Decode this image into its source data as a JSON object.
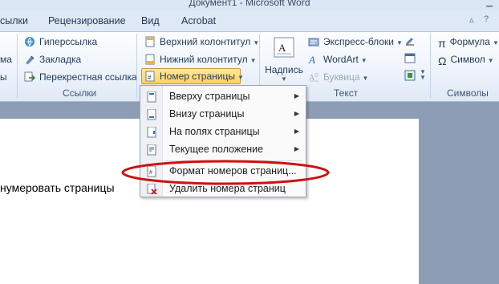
{
  "window": {
    "title": "Документ1 - Microsoft Word"
  },
  "tabs": [
    {
      "label": "сылки",
      "id": "links"
    },
    {
      "label": "Рецензирование",
      "id": "review"
    },
    {
      "label": "Вид",
      "id": "view"
    },
    {
      "label": "Acrobat",
      "id": "acrobat"
    }
  ],
  "ribbon": {
    "left_partial": [
      "ма",
      "ы"
    ],
    "links_group": {
      "label": "Ссылки",
      "items": [
        "Гиперссылка",
        "Закладка",
        "Перекрестная ссылка"
      ]
    },
    "header_footer_group": {
      "items": [
        "Верхний колонтитул",
        "Нижний колонтитул",
        "Номер страницы"
      ]
    },
    "text_group": {
      "label": "Текст",
      "textbox_label": "Надпись",
      "items": [
        "Экспресс-блоки",
        "WordArt",
        "Буквица"
      ]
    },
    "symbols_group": {
      "label": "Символы",
      "items": [
        "Формула",
        "Символ"
      ]
    }
  },
  "document": {
    "visible_text": "нумеровать страницы"
  },
  "menu": {
    "items": [
      {
        "label": "Вверху страницы",
        "submenu": true
      },
      {
        "label": "Внизу страницы",
        "submenu": true
      },
      {
        "label": "На полях страницы",
        "submenu": true
      },
      {
        "label": "Текущее положение",
        "submenu": true
      },
      {
        "label": "Формат номеров страниц...",
        "submenu": false,
        "highlighted_by_annotation": true
      },
      {
        "label": "Удалить номера страниц",
        "submenu": false
      }
    ]
  },
  "colors": {
    "accent_button": "#ffd25e",
    "annotation": "#d01010",
    "ribbon_text": "#1e395b"
  },
  "icons": [
    "hyperlink-icon",
    "bookmark-icon",
    "cross-reference-icon",
    "header-icon",
    "footer-icon",
    "page-number-icon",
    "textbox-icon",
    "quickparts-icon",
    "wordart-icon",
    "dropcap-icon",
    "equation-icon",
    "symbol-icon",
    "delete-page-numbers-icon"
  ]
}
